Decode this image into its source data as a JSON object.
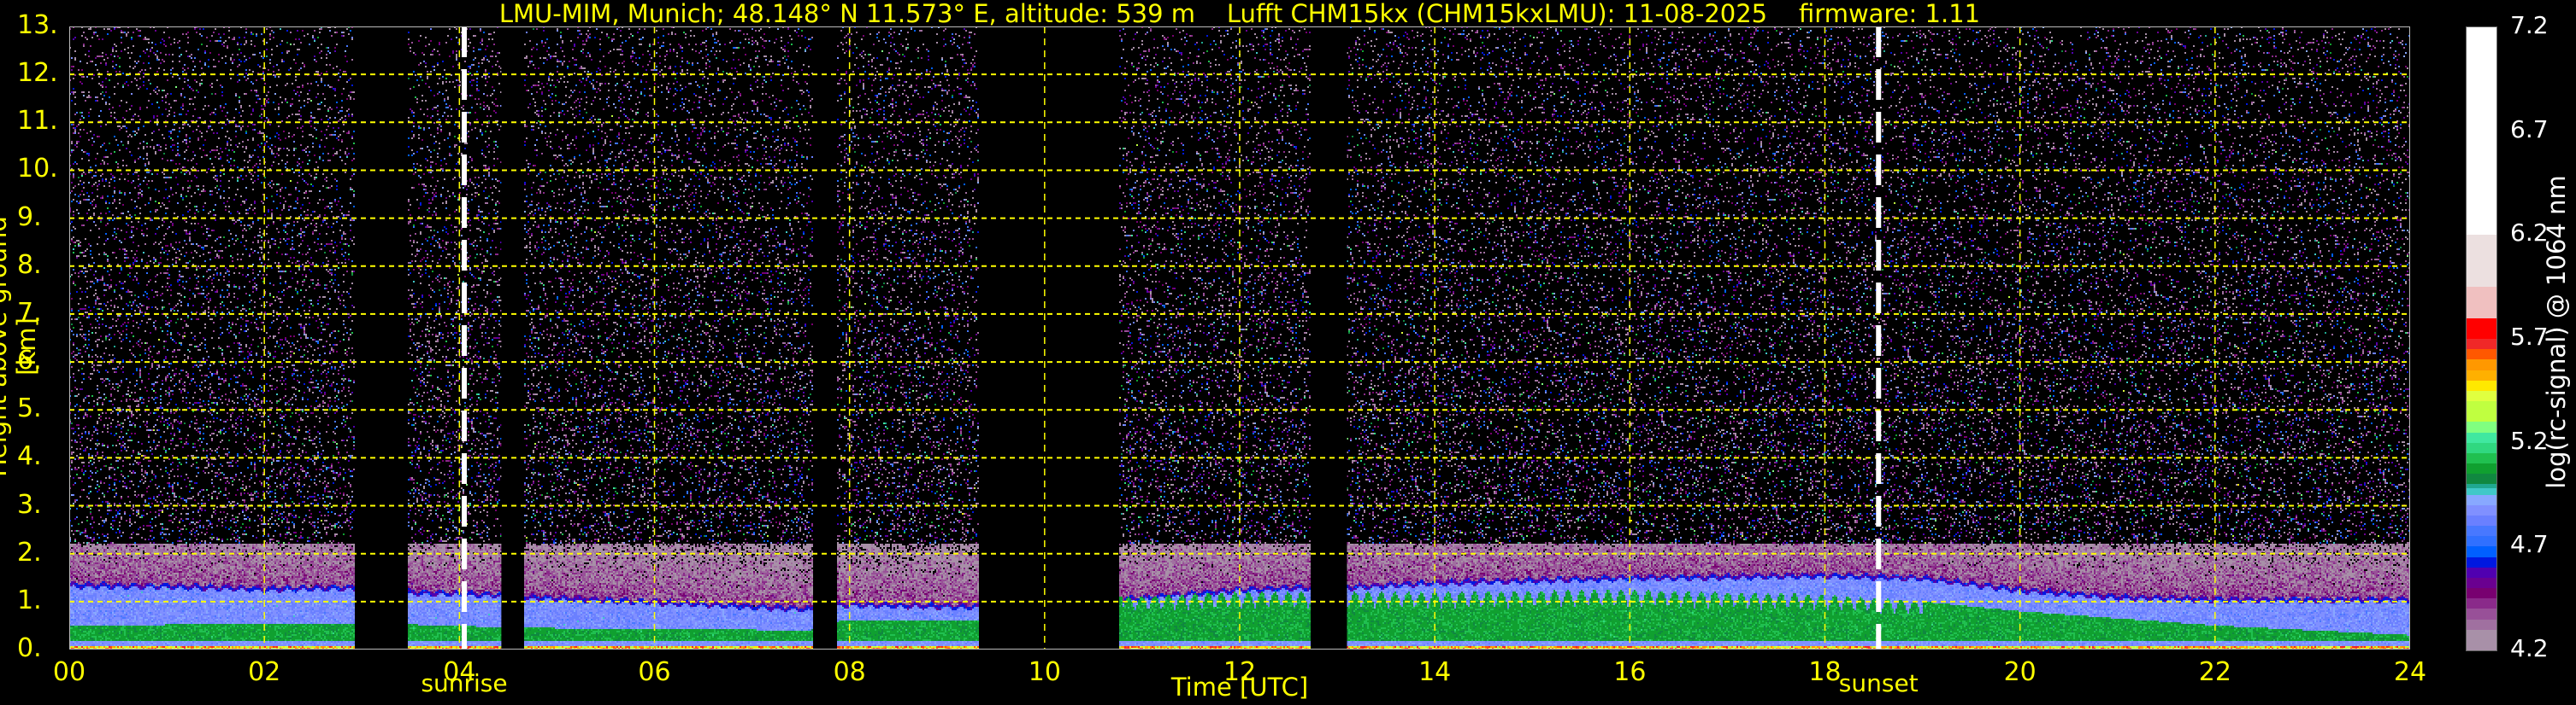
{
  "chart_data": {
    "type": "heatmap",
    "title": "LMU-MIM, Munich; 48.148° N 11.573° E, altitude: 539 m    Lufft CHM15kx (CHM15kxLMU): 11-08-2025    firmware: 1.11",
    "xlabel": "Time [UTC]",
    "ylabel": "Height above ground [km]",
    "xlim": [
      0,
      24
    ],
    "ylim": [
      0,
      13
    ],
    "xticks": [
      "00",
      "02",
      "04",
      "06",
      "08",
      "10",
      "12",
      "14",
      "16",
      "18",
      "20",
      "22",
      "24"
    ],
    "yticks": [
      "0.",
      "1.",
      "2.",
      "3.",
      "4.",
      "5.",
      "6.",
      "7.",
      "8.",
      "9.",
      "10.",
      "11.",
      "12.",
      "13."
    ],
    "grid": true,
    "events": [
      {
        "label": "sunrise",
        "time": 4.05
      },
      {
        "label": "sunset",
        "time": 18.55
      }
    ],
    "data_gaps_hours": [
      [
        2.93,
        3.47
      ],
      [
        4.43,
        4.66
      ],
      [
        7.63,
        7.87
      ],
      [
        9.33,
        10.76
      ],
      [
        12.73,
        13.1
      ]
    ],
    "boundary_layer_top_km": {
      "time": [
        0,
        1,
        2,
        2.9,
        3.5,
        4.4,
        4.7,
        6,
        7.6,
        7.9,
        9.3,
        10.8,
        12,
        12.7,
        13.1,
        14,
        16,
        18,
        19,
        20,
        21,
        22,
        24
      ],
      "height": [
        1.3,
        1.28,
        1.22,
        1.25,
        1.15,
        1.1,
        1.05,
        0.95,
        0.8,
        0.9,
        0.85,
        1.0,
        1.2,
        1.25,
        1.25,
        1.35,
        1.45,
        1.5,
        1.45,
        1.2,
        1.05,
        1.0,
        1.0
      ]
    },
    "aerosol_core_top_km": {
      "time": [
        0,
        3,
        4.7,
        7.6,
        7.9,
        9.3,
        10.8,
        12,
        14,
        16,
        18,
        19,
        20,
        22,
        24
      ],
      "height": [
        0.5,
        0.55,
        0.45,
        0.4,
        0.6,
        0.6,
        1.1,
        1.2,
        1.2,
        1.25,
        1.15,
        1.0,
        0.8,
        0.5,
        0.3
      ]
    },
    "colorbar": {
      "label": "log(rc-signal) @ 1064 nm",
      "range": [
        4.2,
        7.2
      ],
      "ticks": [
        "4.2",
        "4.7",
        "5.2",
        "5.7",
        "6.2",
        "6.7",
        "7.2"
      ],
      "colors": [
        "#a890a8",
        "#a070a0",
        "#985098",
        "#8a2a8a",
        "#780070",
        "#6a0090",
        "#5000b0",
        "#0018e0",
        "#0060ff",
        "#3070ff",
        "#4878ff",
        "#6a80ff",
        "#8090ff",
        "#88a8ff",
        "#40c8c8",
        "#20a890",
        "#108840",
        "#10a030",
        "#20c050",
        "#30d880",
        "#40e8a0",
        "#80ff80",
        "#c0ff40",
        "#e0ff40",
        "#ffe800",
        "#ffb000",
        "#ff9800",
        "#ff5800",
        "#f02828",
        "#ff0000",
        "#f0c0c0",
        "#ece0e0",
        "#ffffff"
      ],
      "color_bounds": [
        4.2,
        4.3,
        4.35,
        4.4,
        4.45,
        4.5,
        4.55,
        4.6,
        4.65,
        4.7,
        4.75,
        4.8,
        4.85,
        4.9,
        4.95,
        4.98,
        5.0,
        5.05,
        5.1,
        5.15,
        5.2,
        5.25,
        5.3,
        5.4,
        5.45,
        5.5,
        5.55,
        5.6,
        5.65,
        5.7,
        5.8,
        5.95,
        6.2,
        7.2
      ]
    }
  }
}
